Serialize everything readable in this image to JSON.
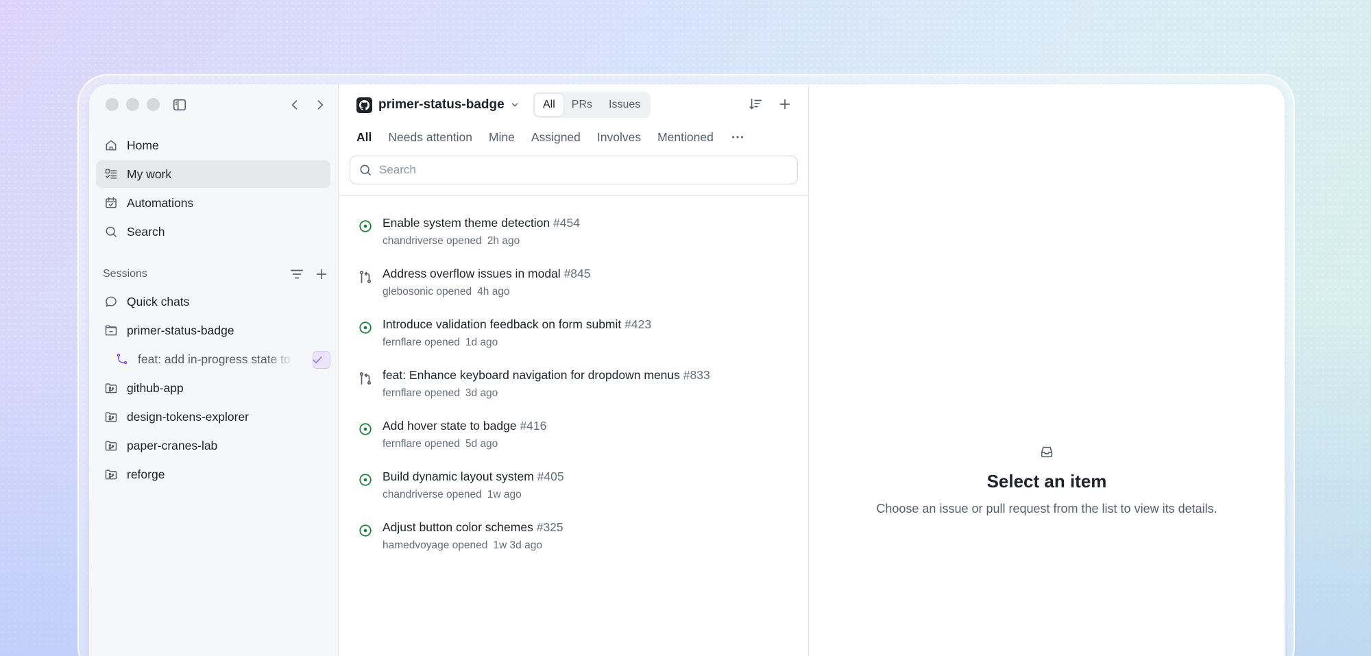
{
  "sidebar": {
    "nav": [
      {
        "label": "Home",
        "icon": "home-icon"
      },
      {
        "label": "My work",
        "icon": "checklist-icon",
        "active": true
      },
      {
        "label": "Automations",
        "icon": "calendar-icon"
      },
      {
        "label": "Search",
        "icon": "search-icon"
      }
    ],
    "sessions_label": "Sessions",
    "sessions": [
      {
        "label": "Quick chats",
        "icon": "chat-bubble-icon"
      },
      {
        "label": "primer-status-badge",
        "icon": "folder-open-icon"
      },
      {
        "label": "feat: add in-progress state to",
        "icon": "git-branch-icon",
        "sub": true
      },
      {
        "label": "github-app",
        "icon": "repo-folder-icon"
      },
      {
        "label": "design-tokens-explorer",
        "icon": "repo-folder-icon"
      },
      {
        "label": "paper-cranes-lab",
        "icon": "repo-folder-icon"
      },
      {
        "label": "reforge",
        "icon": "repo-folder-icon"
      }
    ]
  },
  "list": {
    "repo_name": "primer-status-badge",
    "segments": [
      "All",
      "PRs",
      "Issues"
    ],
    "active_segment": "All",
    "filters": [
      "All",
      "Needs attention",
      "Mine",
      "Assigned",
      "Involves",
      "Mentioned"
    ],
    "active_filter": "All",
    "search_placeholder": "Search",
    "items": [
      {
        "type": "issue",
        "title": "Enable system theme detection",
        "number": "#454",
        "author": "chandriverse opened",
        "time": "2h ago"
      },
      {
        "type": "pr",
        "title": "Address overflow issues in modal",
        "number": "#845",
        "author": "glebosonic opened",
        "time": "4h ago"
      },
      {
        "type": "issue",
        "title": "Introduce validation feedback on form submit",
        "number": "#423",
        "author": "fernflare opened",
        "time": "1d ago"
      },
      {
        "type": "pr",
        "title": "feat: Enhance keyboard navigation for dropdown menus",
        "number": "#833",
        "author": "fernflare opened",
        "time": "3d ago"
      },
      {
        "type": "issue",
        "title": "Add hover state to badge",
        "number": "#416",
        "author": "fernflare opened",
        "time": "5d ago"
      },
      {
        "type": "issue",
        "title": "Build dynamic layout system",
        "number": "#405",
        "author": "chandriverse opened",
        "time": "1w ago"
      },
      {
        "type": "issue",
        "title": "Adjust button color schemes",
        "number": "#325",
        "author": "hamedvoyage opened",
        "time": "1w 3d ago"
      }
    ]
  },
  "detail": {
    "title": "Select an item",
    "subtitle": "Choose an issue or pull request from the list to view its details."
  },
  "colors": {
    "open_issue": "#1a7f37",
    "pr_icon": "#57606a",
    "branch_icon": "#8250df",
    "active_bg": "#e7e8ea"
  }
}
